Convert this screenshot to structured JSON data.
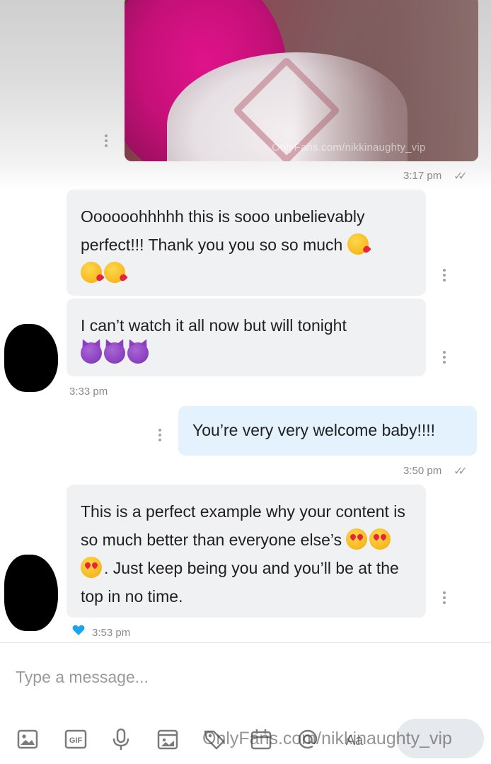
{
  "media": {
    "watermark": "OnlyFans.com/nikkinaughty_vip",
    "timestamp": "3:17 pm",
    "read_receipt": "✓✓"
  },
  "messages": [
    {
      "direction": "incoming",
      "text": "Oooooohhhhh this is sooo unbelievably perfect!!! Thank you you so so much",
      "emoji": "😘😘😘"
    },
    {
      "direction": "incoming",
      "text": "I can’t watch it all now but will tonight",
      "emoji": "😈😈😈",
      "timestamp": "3:33 pm"
    },
    {
      "direction": "outgoing",
      "text": "You’re very very welcome baby!!!!",
      "timestamp": "3:50 pm",
      "read_receipt": "✓✓"
    },
    {
      "direction": "incoming",
      "text_before_emoji": "This is a perfect example why your content is so much better than everyone else’s",
      "emoji": "😍😍😍",
      "text_after_emoji": ". Just keep being you and you’ll be at the top in no time.",
      "timestamp": "3:53 pm",
      "liked": true
    }
  ],
  "composer": {
    "placeholder": "Type a message...",
    "tools": [
      "image-icon",
      "gif-icon",
      "microphone-icon",
      "vault-icon",
      "price-tag-icon",
      "calendar-icon",
      "at-icon",
      "text-format-icon"
    ],
    "gif_label": "GIF",
    "text_format_label": "Aa"
  },
  "footer_watermark": "OnlyFans.com/nikkinaughty_vip",
  "colors": {
    "incoming_bubble": "#f0f1f3",
    "outgoing_bubble": "#e3f2fc",
    "timestamp": "#8a8a8a",
    "like_heart": "#1aa3f0"
  }
}
